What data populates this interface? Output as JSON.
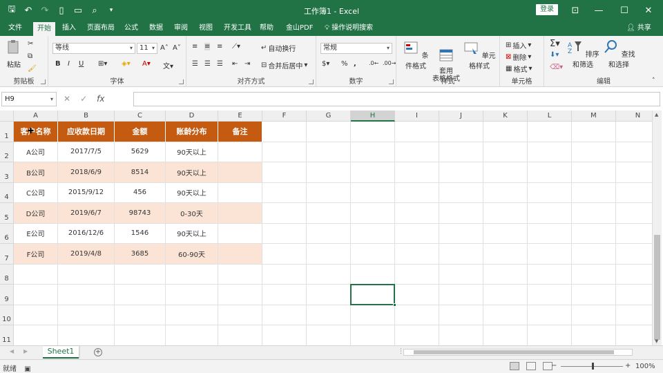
{
  "window": {
    "title": "工作簿1 - Excel",
    "login": "登录"
  },
  "menu": {
    "tabs": [
      "文件",
      "开始",
      "插入",
      "页面布局",
      "公式",
      "数据",
      "审阅",
      "视图",
      "开发工具",
      "帮助",
      "金山PDF",
      "操作说明搜索"
    ],
    "active": "开始",
    "share": "共享"
  },
  "ribbon": {
    "clipboard": {
      "paste": "粘贴",
      "label": "剪贴板"
    },
    "font": {
      "name": "等线",
      "size": "11",
      "bold": "B",
      "italic": "I",
      "underline": "U",
      "grow": "A˄",
      "shrink": "A˅",
      "label": "字体"
    },
    "alignment": {
      "wrap": "自动换行",
      "merge": "合并后居中",
      "label": "对齐方式"
    },
    "number": {
      "format": "常规",
      "percent": "%",
      "comma": ",",
      "label": "数字"
    },
    "styles": {
      "conditional": "条件格式",
      "table": "套用\n表格格式",
      "cell": "单元格样式",
      "label": "样式"
    },
    "cells": {
      "insert": "插入",
      "delete": "删除",
      "format": "格式",
      "label": "单元格"
    },
    "editing": {
      "sort": "排序和筛选",
      "find": "查找和选择",
      "label": "编辑"
    }
  },
  "formula_bar": {
    "name_box": "H9",
    "fx": "fx",
    "content": ""
  },
  "sheet": {
    "columns": [
      "A",
      "B",
      "C",
      "D",
      "E",
      "F",
      "G",
      "H",
      "I",
      "J",
      "K",
      "L",
      "M",
      "N"
    ],
    "selected_column": "H",
    "selected_cell": "H9",
    "rows": [
      "1",
      "2",
      "3",
      "4",
      "5",
      "6",
      "7",
      "8",
      "9",
      "10",
      "11"
    ],
    "table_header": [
      "客户名称",
      "应收款日期",
      "金额",
      "账龄分布",
      "备注"
    ],
    "table_rows": [
      [
        "A公司",
        "2017/7/5",
        "5629",
        "90天以上",
        ""
      ],
      [
        "B公司",
        "2018/6/9",
        "8514",
        "90天以上",
        ""
      ],
      [
        "C公司",
        "2015/9/12",
        "456",
        "90天以上",
        ""
      ],
      [
        "D公司",
        "2019/6/7",
        "98743",
        "0-30天",
        ""
      ],
      [
        "E公司",
        "2016/12/6",
        "1546",
        "90天以上",
        ""
      ],
      [
        "F公司",
        "2019/4/8",
        "3685",
        "60-90天",
        ""
      ]
    ],
    "header_color": "#c55a11",
    "band_color": "#fbe4d5"
  },
  "sheet_tabs": {
    "active": "Sheet1"
  },
  "status": {
    "ready": "就绪",
    "zoom": "100%"
  },
  "colors": {
    "accent": "#217346"
  }
}
